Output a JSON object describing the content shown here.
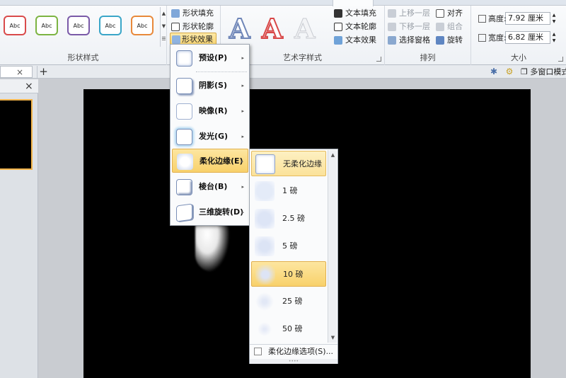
{
  "ribbon": {
    "shape_styles": {
      "label": "形状样式",
      "swatches": [
        {
          "text": "Abc",
          "color": "#d94b4b"
        },
        {
          "text": "Abc",
          "color": "#7cb442"
        },
        {
          "text": "Abc",
          "color": "#7a5aa8"
        },
        {
          "text": "Abc",
          "color": "#3aa6c8"
        },
        {
          "text": "Abc",
          "color": "#e8893a"
        }
      ],
      "fill": "形状填充",
      "outline": "形状轮廓",
      "effects": "形状效果"
    },
    "wordart": {
      "label": "艺术字样式",
      "letters": [
        {
          "text": "A",
          "color": "#6f86b8"
        },
        {
          "text": "A",
          "color": "#d84848"
        },
        {
          "text": "A",
          "color": "#d6d9de"
        }
      ],
      "text_fill": "文本填充",
      "text_outline": "文本轮廓",
      "text_effects": "文本效果"
    },
    "arrange": {
      "label": "排列",
      "bring_forward": "上移一层",
      "send_backward": "下移一层",
      "selection_pane": "选择窗格",
      "align": "对齐",
      "group": "组合",
      "rotate": "旋转"
    },
    "size": {
      "label": "大小",
      "height_label": "高度:",
      "height_value": "7.92 厘米",
      "width_label": "宽度:",
      "width_value": "6.82 厘米"
    }
  },
  "subbar": {
    "tab_close": "×",
    "new_tab": "+",
    "multi_window": "多窗口模式"
  },
  "left_panel": {
    "close": "×"
  },
  "effects_menu": {
    "items": [
      {
        "label": "预设(P)",
        "arrow": "▸"
      },
      {
        "label": "阴影(S)",
        "arrow": "▸"
      },
      {
        "label": "映像(R)",
        "arrow": "▸"
      },
      {
        "label": "发光(G)",
        "arrow": "▸"
      },
      {
        "label": "柔化边缘(E)",
        "arrow": "▸"
      },
      {
        "label": "棱台(B)",
        "arrow": "▸"
      },
      {
        "label": "三维旋转(D)",
        "arrow": "▸"
      }
    ],
    "highlighted_index": 4
  },
  "soft_edges_menu": {
    "items": [
      {
        "label": "无柔化边缘"
      },
      {
        "label": "1 磅"
      },
      {
        "label": "2.5 磅"
      },
      {
        "label": "5 磅"
      },
      {
        "label": "10 磅"
      },
      {
        "label": "25 磅"
      },
      {
        "label": "50 磅"
      }
    ],
    "selected_index": 0,
    "hover_index": 4,
    "options_label": "柔化边缘选项(S)..."
  }
}
